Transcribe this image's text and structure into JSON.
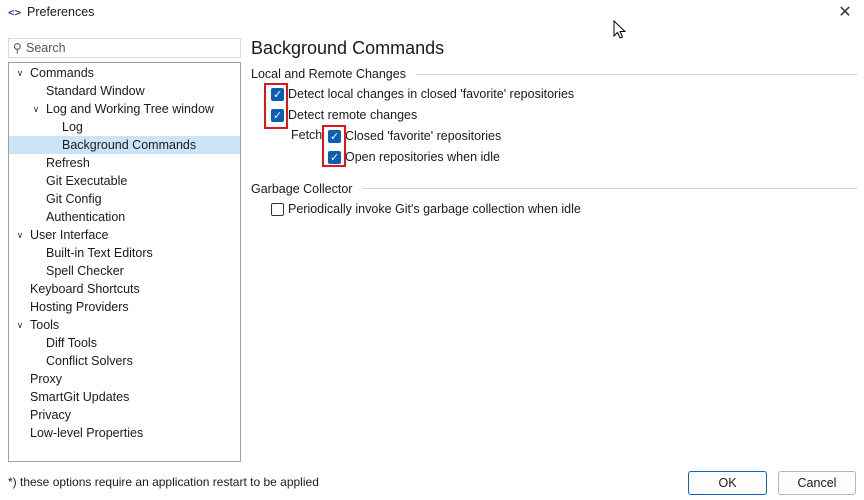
{
  "window": {
    "icon_glyph": "<>",
    "title": "Preferences",
    "close_glyph": "✕"
  },
  "search": {
    "placeholder": "Search",
    "value": ""
  },
  "tree": [
    {
      "label": "Commands",
      "expanded": true
    },
    {
      "label": "Standard Window"
    },
    {
      "label": "Log and Working Tree window",
      "expanded": true
    },
    {
      "label": "Log"
    },
    {
      "label": "Background Commands",
      "selected": true
    },
    {
      "label": "Refresh"
    },
    {
      "label": "Git Executable"
    },
    {
      "label": "Git Config"
    },
    {
      "label": "Authentication"
    },
    {
      "label": "User Interface",
      "expanded": true
    },
    {
      "label": "Built-in Text Editors"
    },
    {
      "label": "Spell Checker"
    },
    {
      "label": "Keyboard Shortcuts"
    },
    {
      "label": "Hosting Providers"
    },
    {
      "label": "Tools",
      "expanded": true
    },
    {
      "label": "Diff Tools"
    },
    {
      "label": "Conflict Solvers"
    },
    {
      "label": "Proxy"
    },
    {
      "label": "SmartGit Updates"
    },
    {
      "label": "Privacy"
    },
    {
      "label": "Low-level Properties"
    }
  ],
  "content": {
    "title": "Background Commands",
    "local_remote": {
      "label": "Local and Remote Changes",
      "detect_local": {
        "label": "Detect local changes in closed 'favorite' repositories",
        "checked": true
      },
      "detect_remote": {
        "label": "Detect remote changes",
        "checked": true
      },
      "fetch_label": "Fetch",
      "closed_favorite": {
        "label": "Closed 'favorite' repositories",
        "checked": true
      },
      "open_idle": {
        "label": "Open repositories when idle",
        "checked": true
      }
    },
    "garbage": {
      "label": "Garbage Collector",
      "periodic_gc": {
        "label": "Periodically invoke Git's garbage collection when idle",
        "checked": false
      }
    }
  },
  "footer": {
    "note": "*) these options require an application restart to be applied",
    "ok_label": "OK",
    "cancel_label": "Cancel"
  },
  "colors": {
    "accent": "#0a5fb4",
    "selection": "#cce4f7",
    "highlight_box": "#e1141b"
  }
}
